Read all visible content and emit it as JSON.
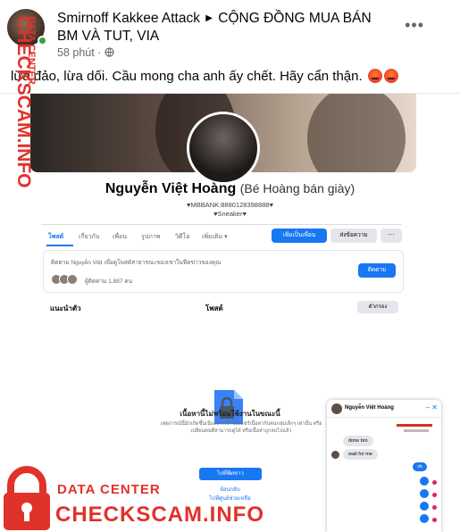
{
  "post": {
    "author": "Smirnoff Kakkee Attack",
    "group": "CỘNG ĐỒNG MUA BÁN BM VÀ TUT, VIA",
    "time": "58 phút",
    "text": "lừa đảo, lừa dối. Cầu mong cha anh ấy chết. Hãy cẩn thận."
  },
  "profile": {
    "name": "Nguyễn Việt Hoàng",
    "alt_name": "(Bé Hoàng bán giày)",
    "bio_line1": "♥MBBANK:8880128398888♥",
    "bio_line2": "♥Sneaker♥",
    "tabs": [
      "โพสต์",
      "เกี่ยวกับ",
      "เพื่อน",
      "รูปภาพ",
      "วิดีโอ",
      "เพิ่มเติม ▾"
    ],
    "add_friend": "เพิ่มเป็นเพื่อน",
    "message": "ส่งข้อความ",
    "follow_text": "ติดตาม Nguyễn Việt เพื่อดูโพสต์สาธารณะของเขาในฟีดข่าวของคุณ",
    "follow_count": "ผู้ติดตาม 1,887 คน",
    "follow_button": "ติดตาม",
    "intro": "แนะนำตัว",
    "posts": "โพสต์",
    "filter": "ตัวกรอง"
  },
  "unavailable": {
    "title": "เนื้อหานี้ไม่พร้อมใช้งานในขณะนี้",
    "text": "เหตุการณ์นี้มักเกิดขึ้นเนื่องจากเจ้าของแชร์เนื้อหากับคนกลุ่มเล็กๆ เท่านั้น หรือเปลี่ยนคนที่สามารถดูได้ หรือเนื้อหาถูกลบไปแล้ว",
    "button": "ไปที่ฟีดข่าว",
    "link1": "ย้อนกลับ",
    "link2": "ไปที่ศูนย์ช่วยเหลือ"
  },
  "chat": {
    "name": "Nguyễn Việt Hoàng",
    "msg1": "done bro",
    "msg2": "wait for me",
    "msg3": "ok"
  },
  "watermark": {
    "vertical_top": "DATA CENTER",
    "vertical_big": "CHECKSCAM.INFO",
    "data_center": "DATA CENTER",
    "checkscam": "CHECKSCAM.INFO"
  },
  "colors": {
    "brand_blue": "#1877f2",
    "watermark_red": "#e0322a",
    "online_green": "#31a24c"
  }
}
